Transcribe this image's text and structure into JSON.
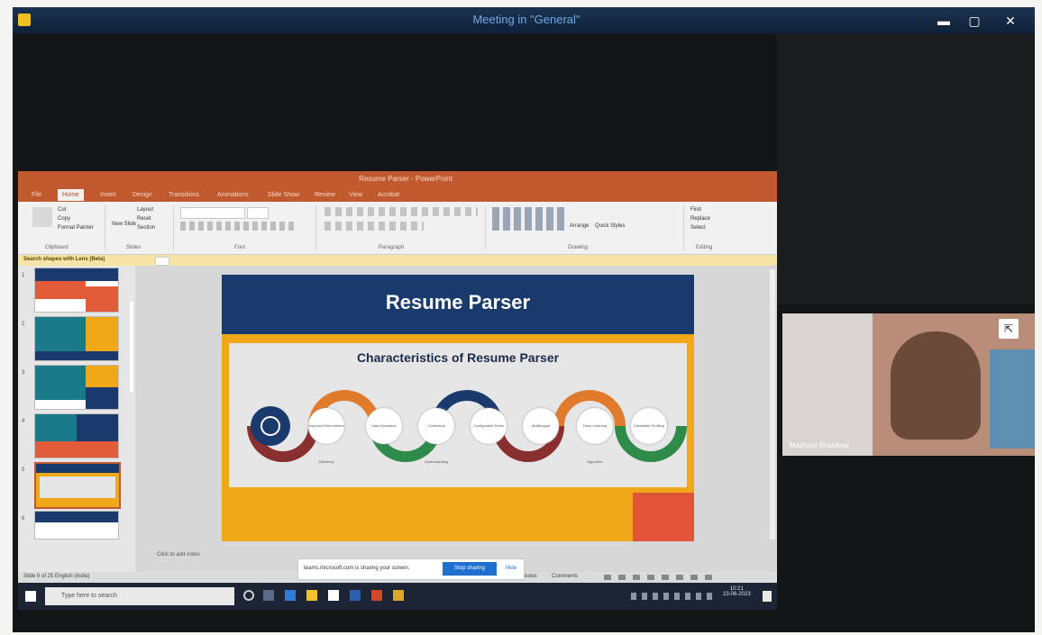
{
  "meeting": {
    "title": "Meeting in \"General\"",
    "participant_name": "Madhavi Bhardwaj"
  },
  "window_controls": {
    "minimize": "▬",
    "maximize": "▢",
    "close": "✕"
  },
  "powerpoint": {
    "title_bar": "Resume Parser - PowerPoint",
    "tabs": [
      "File",
      "Home",
      "Insert",
      "Design",
      "Transitions",
      "Animations",
      "Slide Show",
      "Review",
      "View",
      "Acrobat"
    ],
    "active_tab": "Home",
    "ribbon": {
      "clipboard": {
        "cut": "Cut",
        "copy": "Copy",
        "format_painter": "Format Painter",
        "group": "Clipboard"
      },
      "slides": {
        "new_slide": "New Slide",
        "layout": "Layout",
        "reset": "Reset",
        "section": "Section",
        "group": "Slides"
      },
      "font_group": "Font",
      "paragraph_group": "Paragraph",
      "drawing_group": "Drawing",
      "editing": {
        "find": "Find",
        "replace": "Replace",
        "select": "Select",
        "group": "Editing"
      },
      "arrange_label": "Arrange",
      "quick_styles": "Quick Styles"
    },
    "notice_text": "Search shapes with Lens (Beta)",
    "slide_numbers": [
      "1",
      "2",
      "3",
      "4",
      "5",
      "6"
    ],
    "status_text": "Slide 5 of 25   English (India)",
    "notes_hint": "Click to add notes",
    "status_notes": "Notes",
    "status_comments": "Comments"
  },
  "slide": {
    "title": "Resume Parser",
    "subtitle": "Characteristics of Resume Parser",
    "items": [
      "Improved Recruitment Efficiency",
      "Data Extraction",
      "Contextual Understanding",
      "Configurable Rules",
      "Multilingual",
      "Deep Learning Algorithm",
      "Candidate Profiling"
    ]
  },
  "share_bar": {
    "text": "teams.microsoft.com is sharing your screen.",
    "stop_label": "Stop sharing",
    "hide_label": "Hide"
  },
  "taskbar": {
    "search_placeholder": "Type here to search",
    "time": "10:21",
    "date": "23-06-2023"
  },
  "colors": {
    "slide_header": "#1a3a6e",
    "slide_accent": "#f0a818",
    "slide_red": "#e0553a",
    "ppt_orange": "#c05a2e",
    "teams_blue": "#1f6fd1"
  }
}
